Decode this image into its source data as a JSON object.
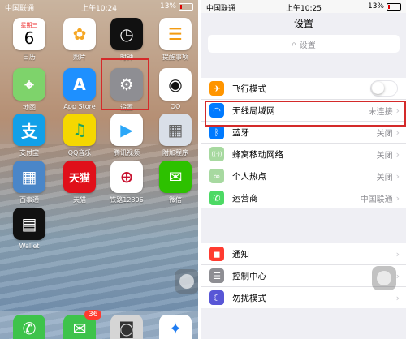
{
  "left": {
    "status": {
      "carrier": "中国联通",
      "time": "上午10:24",
      "battery": "13%"
    },
    "apps": [
      {
        "name": "calendar",
        "label": "日历",
        "weekday": "星期三",
        "day": "6",
        "color": "#ffffff",
        "text_color": "#e33"
      },
      {
        "name": "photos",
        "label": "照片",
        "icon": "photos-icon",
        "glyph": "✿",
        "color": "#ffffff",
        "text_color": "#f5a623"
      },
      {
        "name": "clock",
        "label": "时钟",
        "icon": "clock-icon",
        "glyph": "◷",
        "color": "#111111",
        "text_color": "#ffffff"
      },
      {
        "name": "reminders",
        "label": "提醒事项",
        "icon": "reminders-icon",
        "glyph": "☰",
        "color": "#ffffff",
        "text_color": "#f39c12"
      },
      {
        "name": "maps",
        "label": "地图",
        "icon": "maps-icon",
        "glyph": "⌖",
        "color": "#7ed36b",
        "text_color": "#ffffff"
      },
      {
        "name": "app-store",
        "label": "App Store",
        "icon": "app-store-icon",
        "glyph": "A",
        "color": "#1e90ff",
        "text_color": "#ffffff"
      },
      {
        "name": "settings",
        "label": "设置",
        "icon": "gear-icon",
        "glyph": "⚙",
        "color": "#8e8e93",
        "text_color": "#ffffff"
      },
      {
        "name": "qq",
        "label": "QQ",
        "icon": "penguin-icon",
        "glyph": "◉",
        "color": "#ffffff",
        "text_color": "#111"
      },
      {
        "name": "alipay",
        "label": "支付宝",
        "icon": "alipay-icon",
        "glyph": "支",
        "color": "#12a0e8",
        "text_color": "#ffffff"
      },
      {
        "name": "qq-music",
        "label": "QQ音乐",
        "icon": "music-icon",
        "glyph": "♫",
        "color": "#f5d700",
        "text_color": "#1aa260"
      },
      {
        "name": "tencent-video",
        "label": "腾讯视频",
        "icon": "video-icon",
        "glyph": "▶",
        "color": "#ffffff",
        "text_color": "#2ca7f8"
      },
      {
        "name": "extras-folder",
        "label": "附加程序",
        "icon": "folder-icon",
        "glyph": "▦",
        "color": "#d9dfe8",
        "text_color": "#666"
      },
      {
        "name": "baishitong",
        "label": "百事通",
        "icon": "folder-icon",
        "glyph": "▦",
        "color": "#4a86c8",
        "text_color": "#ffffff"
      },
      {
        "name": "tmall",
        "label": "天猫",
        "icon": "tmall-icon",
        "glyph": "天猫",
        "color": "#e0101a",
        "text_color": "#ffffff"
      },
      {
        "name": "railway",
        "label": "铁路12306",
        "icon": "railway-icon",
        "glyph": "⊕",
        "color": "#ffffff",
        "text_color": "#c8102e"
      },
      {
        "name": "wechat",
        "label": "微信",
        "icon": "wechat-icon",
        "glyph": "✉",
        "color": "#2dc100",
        "text_color": "#ffffff"
      },
      {
        "name": "wallet",
        "label": "Wallet",
        "icon": "wallet-icon",
        "glyph": "▤",
        "color": "#111111",
        "text_color": "#ffffff"
      }
    ],
    "dock": [
      {
        "name": "phone",
        "icon": "phone-icon",
        "glyph": "✆",
        "color": "#3ec34b"
      },
      {
        "name": "messages",
        "icon": "messages-icon",
        "glyph": "✉",
        "color": "#3ec34b",
        "badge": "36"
      },
      {
        "name": "camera",
        "icon": "camera-icon",
        "glyph": "◙",
        "color": "#d5d5d5"
      },
      {
        "name": "safari",
        "icon": "safari-icon",
        "glyph": "✦",
        "color": "#ffffff"
      }
    ]
  },
  "right": {
    "status": {
      "carrier": "中国联通",
      "time": "上午10:25",
      "battery": "13%"
    },
    "title": "设置",
    "search_placeholder": "设置",
    "groups": [
      [
        {
          "name": "airplane-mode",
          "label": "飞行模式",
          "icon": "airplane-icon",
          "glyph": "✈",
          "color": "#ff9500",
          "toggle": true
        },
        {
          "name": "wifi",
          "label": "无线局域网",
          "icon": "wifi-icon",
          "glyph": "◠",
          "color": "#007aff",
          "value": "未连接",
          "highlighted": true
        },
        {
          "name": "bluetooth",
          "label": "蓝牙",
          "icon": "bluetooth-icon",
          "glyph": "ᛒ",
          "color": "#007aff",
          "value": "关闭"
        },
        {
          "name": "cellular",
          "label": "蜂窝移动网络",
          "icon": "cellular-icon",
          "glyph": "((·))",
          "color": "#a7d9a0",
          "value": "关闭"
        },
        {
          "name": "hotspot",
          "label": "个人热点",
          "icon": "hotspot-icon",
          "glyph": "∞",
          "color": "#a7d9a0",
          "value": "关闭"
        },
        {
          "name": "carrier",
          "label": "运营商",
          "icon": "phone-icon",
          "glyph": "✆",
          "color": "#4cd964",
          "value": "中国联通"
        }
      ],
      [
        {
          "name": "notifications",
          "label": "通知",
          "icon": "notification-icon",
          "glyph": "◼",
          "color": "#ff3b30"
        },
        {
          "name": "control-center",
          "label": "控制中心",
          "icon": "control-center-icon",
          "glyph": "☰",
          "color": "#8e8e93"
        },
        {
          "name": "do-not-disturb",
          "label": "勿扰模式",
          "icon": "moon-icon",
          "glyph": "☾",
          "color": "#5856d6"
        }
      ]
    ]
  }
}
